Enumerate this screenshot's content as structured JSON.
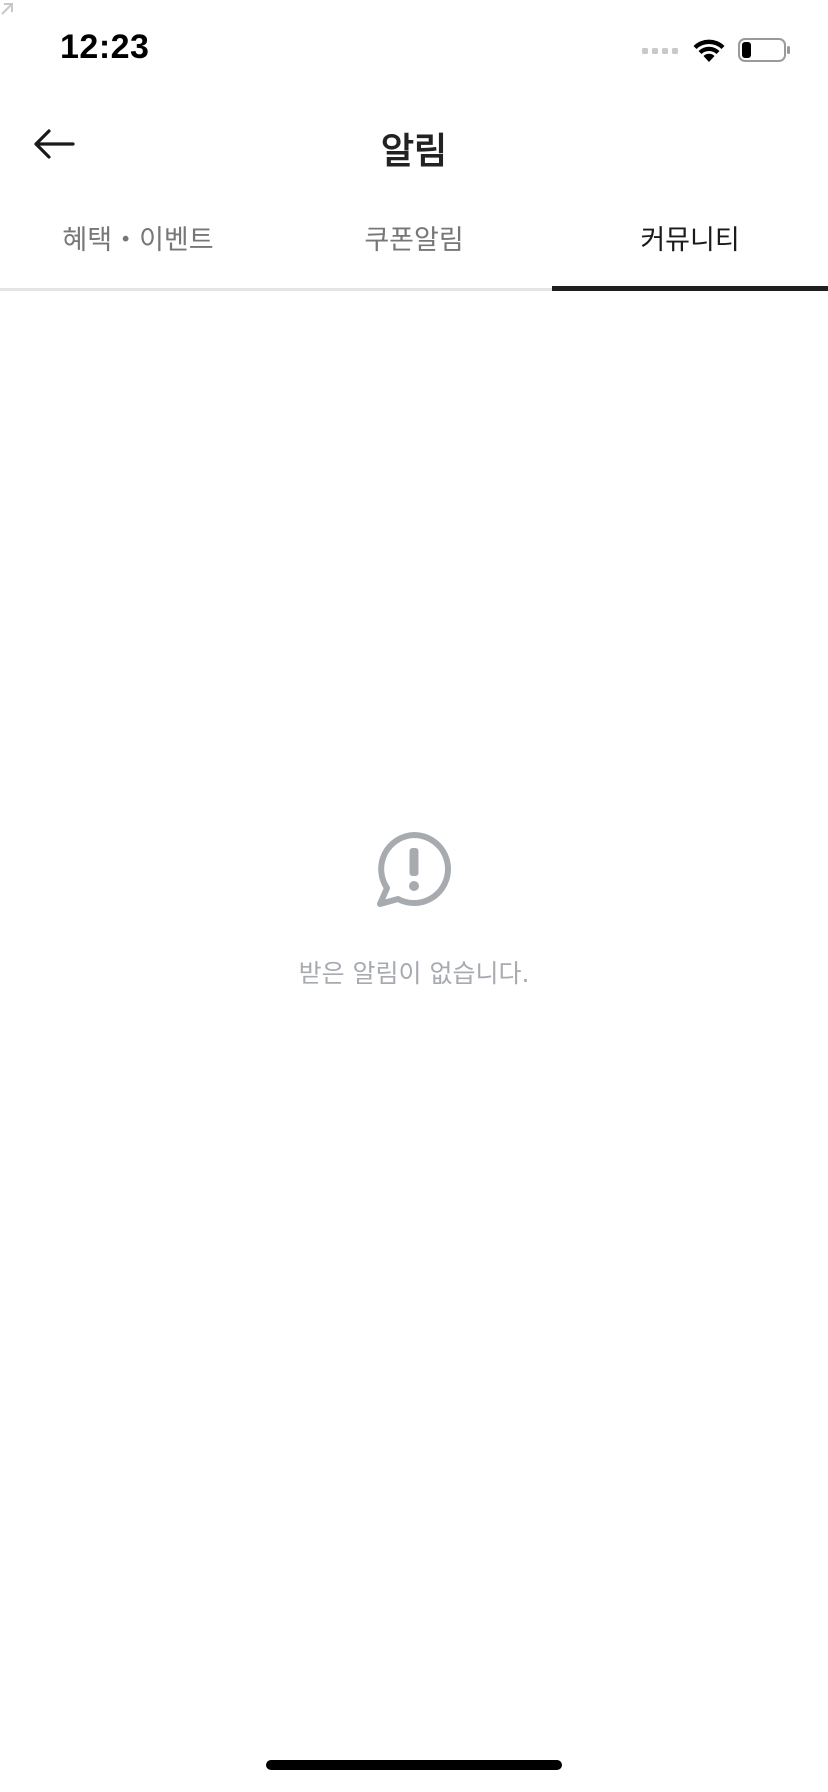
{
  "status_bar": {
    "time": "12:23",
    "signal_icon": "cellular-signal-icon",
    "wifi_icon": "wifi-icon",
    "battery_icon": "battery-icon",
    "battery_level": 0.2
  },
  "nav": {
    "back_icon": "arrow-left-icon",
    "title": "알림"
  },
  "tabs": [
    {
      "label": "혜택・이벤트",
      "active": false
    },
    {
      "label": "쿠폰알림",
      "active": false
    },
    {
      "label": "커뮤니티",
      "active": true
    }
  ],
  "empty_state": {
    "icon": "speech-bubble-exclamation-icon",
    "message": "받은 알림이 없습니다."
  },
  "colors": {
    "title_text": "#222222",
    "tab_inactive": "#777777",
    "tab_active": "#1a1a1a",
    "tab_indicator": "#1f1f1f",
    "tab_divider": "#e4e4e4",
    "empty_icon": "#a7abb0",
    "empty_text": "#a7abb0",
    "background": "#ffffff"
  }
}
